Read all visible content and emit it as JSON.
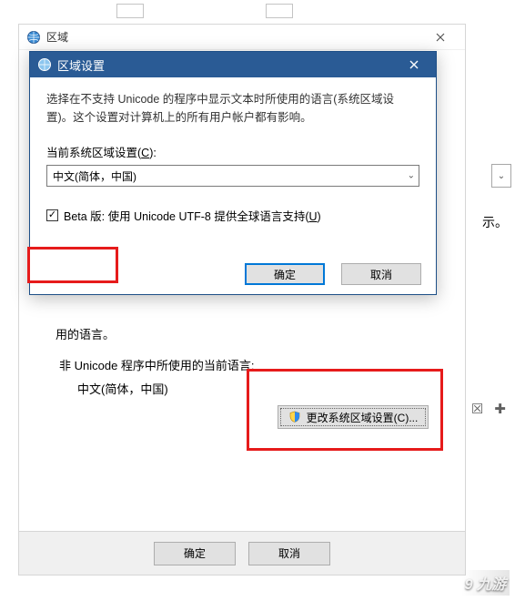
{
  "outer": {
    "title": "区域",
    "used_language_label": "用的语言。",
    "non_unicode_label": "非 Unicode 程序中所使用的当前语言:",
    "non_unicode_value": "中文(简体，中国)",
    "change_locale_btn": "更改系统区域设置(C)...",
    "ok": "确定",
    "cancel": "取消"
  },
  "inner": {
    "title": "区域设置",
    "description": "选择在不支持 Unicode 的程序中显示文本时所使用的语言(系统区域设置)。这个设置对计算机上的所有用户帐户都有影响。",
    "locale_label_pre": "当前系统区域设置(",
    "locale_label_hot": "C",
    "locale_label_post": "):",
    "locale_value": "中文(简体，中国)",
    "checkbox_checked": "✓",
    "checkbox_label_pre": "Beta 版: 使用 Unicode UTF-8 提供全球语言支持(",
    "checkbox_hot": "U",
    "checkbox_label_post": ")",
    "ok": "确定",
    "cancel": "取消"
  },
  "fragments": {
    "right_text": "示。",
    "watermark": "9 九游"
  }
}
